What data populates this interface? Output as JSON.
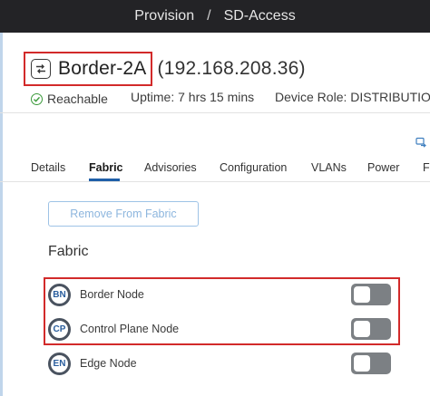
{
  "breadcrumb": {
    "items": [
      "Provision",
      "SD-Access"
    ],
    "separator": "/"
  },
  "device": {
    "name": "Border-2A",
    "ip": "(192.168.208.36)",
    "reachability": "Reachable",
    "uptime": "Uptime: 7 hrs 15 mins",
    "role": "Device Role: DISTRIBUTION"
  },
  "tabs": [
    {
      "label": "Details"
    },
    {
      "label": "Fabric",
      "active": true
    },
    {
      "label": "Advisories"
    },
    {
      "label": "Configuration"
    },
    {
      "label": "VLANs"
    },
    {
      "label": "Power"
    },
    {
      "label": "F"
    }
  ],
  "fabric": {
    "remove_button": "Remove From Fabric",
    "section_title": "Fabric",
    "nodes": [
      {
        "badge": "BN",
        "label": "Border Node",
        "enabled": false
      },
      {
        "badge": "CP",
        "label": "Control Plane Node",
        "enabled": false
      },
      {
        "badge": "EN",
        "label": "Edge Node",
        "enabled": false
      }
    ]
  },
  "colors": {
    "topbar": "#232326",
    "highlight": "#d22a2a",
    "accent": "#1f5fa8",
    "reachable": "#3a9a3a"
  },
  "icons": {
    "device": "switch-icon",
    "status": "check-circle-icon",
    "export": "export-icon"
  }
}
